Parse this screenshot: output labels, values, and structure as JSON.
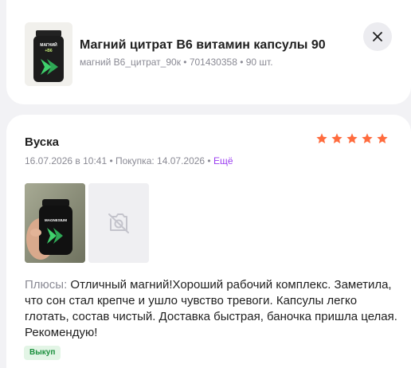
{
  "product": {
    "title": "Магний цитрат В6 витамин капсулы 90",
    "meta": "магний В6_цитрат_90к • 701430358 • 90 шт.",
    "thumb_label_line1": "МАГНИЙ",
    "thumb_label_line2": "+B6"
  },
  "close_button": {
    "icon": "close-icon"
  },
  "review": {
    "author": "Вуска",
    "rating": 5,
    "rating_max": 5,
    "star_color": "#ff6b3d",
    "meta": "16.07.2026 в 10:41 • Покупка: 14.07.2026 • ",
    "more_label": "Ещё",
    "photos": [
      {
        "icon": "product-photo",
        "caption": "MAGNESIUM"
      },
      {
        "icon": "image-placeholder-icon"
      }
    ],
    "pros_label": "Плюсы:",
    "pros_text": " Отличный магний!Хороший рабочий комплекс. Заметила, что сон стал крепче и ушло чувство тревоги. Капсулы легко глотать, состав чистый. Доставка быстрая, баночка пришла целая. Рекомендую!",
    "badge": "Выкуп"
  },
  "colors": {
    "accent_link": "#9b3df0",
    "badge_bg": "#e3f5e6",
    "badge_text": "#1a8f3c"
  }
}
